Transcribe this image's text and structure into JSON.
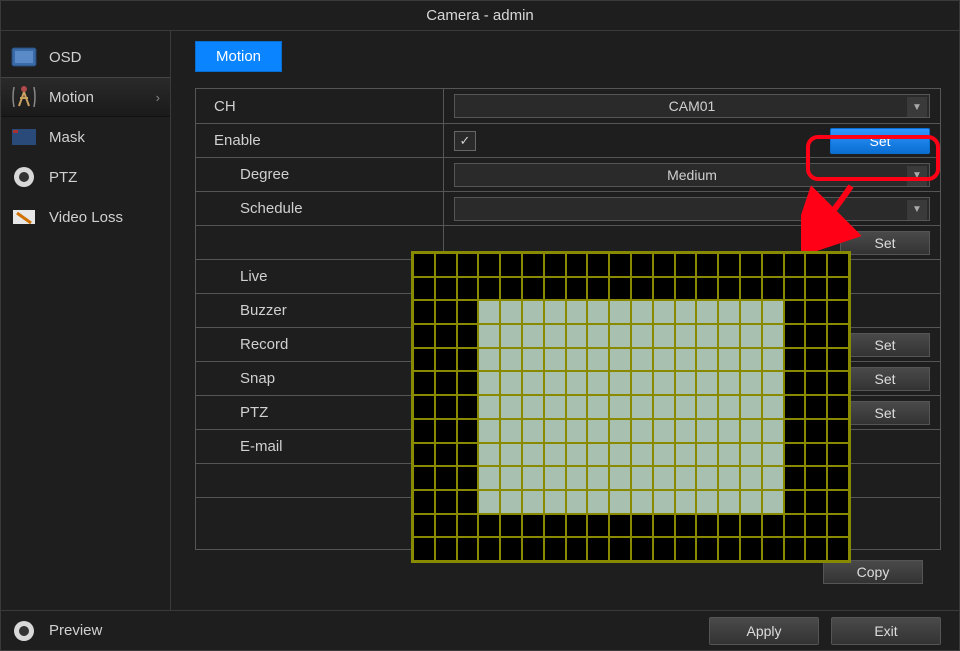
{
  "title": "Camera - admin",
  "sidebar": {
    "items": [
      {
        "label": "OSD"
      },
      {
        "label": "Motion"
      },
      {
        "label": "Mask"
      },
      {
        "label": "PTZ"
      },
      {
        "label": "Video Loss"
      }
    ]
  },
  "tab": {
    "label": "Motion"
  },
  "rows": {
    "ch_label": "CH",
    "ch_value": "CAM01",
    "enable_label": "Enable",
    "enable_checked": "✓",
    "enable_set": "Set",
    "degree_label": "Degree",
    "degree_value": "Medium",
    "schedule_label": "Schedule",
    "schedule_set": "Set",
    "live_label": "Live",
    "buzzer_label": "Buzzer",
    "record_label": "Record",
    "record_set": "Set",
    "snap_label": "Snap",
    "snap_set": "Set",
    "ptz_label": "PTZ",
    "ptz_set": "Set",
    "email_label": "E-mail"
  },
  "buttons": {
    "copy": "Copy",
    "apply": "Apply",
    "exit": "Exit"
  },
  "footer": {
    "preview": "Preview"
  }
}
